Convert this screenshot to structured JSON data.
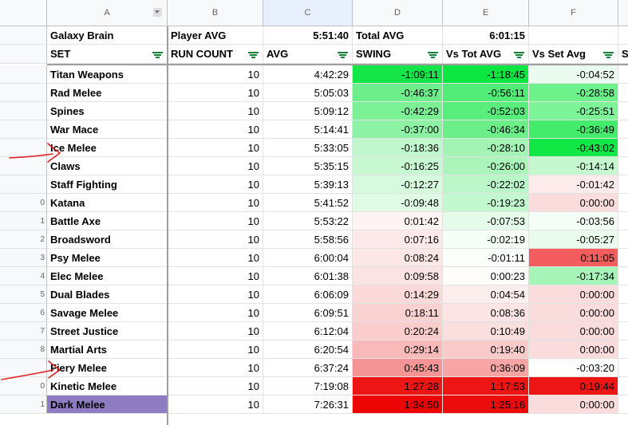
{
  "columns": [
    {
      "letter": "A",
      "selected": false,
      "dropdown": true
    },
    {
      "letter": "B",
      "selected": false,
      "dropdown": false
    },
    {
      "letter": "C",
      "selected": true,
      "dropdown": false
    },
    {
      "letter": "D",
      "selected": false,
      "dropdown": false
    },
    {
      "letter": "E",
      "selected": false,
      "dropdown": false
    },
    {
      "letter": "F",
      "selected": false,
      "dropdown": false
    }
  ],
  "summary": {
    "a": "Galaxy Brain",
    "b": "Player AVG",
    "c": "5:51:40",
    "d": "Total AVG",
    "e": "6:01:15",
    "f": ""
  },
  "headers": [
    "SET",
    "RUN COUNT",
    "AVG",
    "SWING",
    "Vs Tot AVG",
    "Vs Set Avg",
    "S"
  ],
  "row_numbers": [
    "",
    "",
    "",
    "",
    "",
    "",
    "",
    "",
    "",
    "0",
    "1",
    "2",
    "3",
    "4",
    "5",
    "6",
    "7",
    "8",
    "",
    "0",
    "1"
  ],
  "rows": [
    {
      "set": "Titan Weapons",
      "count": "10",
      "avg": "4:42:29",
      "swing": "-1:09:11",
      "vs_tot": "-1:18:45",
      "vs_set": "-0:04:52",
      "c_swing": "#16e54a",
      "c_tot": "#0be740",
      "c_set": "#ecfbef"
    },
    {
      "set": "Rad Melee",
      "count": "10",
      "avg": "5:05:03",
      "swing": "-0:46:37",
      "vs_tot": "-0:56:11",
      "vs_set": "-0:28:58",
      "c_swing": "#6eee8a",
      "c_tot": "#50ec75",
      "c_set": "#6df28b"
    },
    {
      "set": "Spines",
      "count": "10",
      "avg": "5:09:12",
      "swing": "-0:42:29",
      "vs_tot": "-0:52:03",
      "vs_set": "-0:25:51",
      "c_swing": "#7bf095",
      "c_tot": "#59ed7b",
      "c_set": "#7ef498"
    },
    {
      "set": "War Mace",
      "count": "10",
      "avg": "5:14:41",
      "swing": "-0:37:00",
      "vs_tot": "-0:46:34",
      "vs_set": "-0:36:49",
      "c_swing": "#8df2a3",
      "c_tot": "#6cef89",
      "c_set": "#43ed6b"
    },
    {
      "set": "Ice Melee",
      "count": "10",
      "avg": "5:33:05",
      "swing": "-0:18:36",
      "vs_tot": "-0:28:10",
      "vs_set": "-0:43:02",
      "c_swing": "#c1f7cc",
      "c_tot": "#a2f3b4",
      "c_set": "#11e845"
    },
    {
      "set": "Claws",
      "count": "10",
      "avg": "5:35:15",
      "swing": "-0:16:25",
      "vs_tot": "-0:26:00",
      "vs_set": "-0:14:14",
      "c_swing": "#c8f8d2",
      "c_tot": "#abf5bb",
      "c_set": "#c5f8cf"
    },
    {
      "set": "Staff Fighting",
      "count": "10",
      "avg": "5:39:13",
      "swing": "-0:12:27",
      "vs_tot": "-0:22:02",
      "vs_set": "-0:01:42",
      "c_swing": "#d6fadd",
      "c_tot": "#baf6c7",
      "c_set": "#fdeaea"
    },
    {
      "set": "Katana",
      "count": "10",
      "avg": "5:41:52",
      "swing": "-0:09:48",
      "vs_tot": "-0:19:23",
      "vs_set": "0:00:00",
      "c_swing": "#dffbe5",
      "c_tot": "#c2f8cd",
      "c_set": "#fbdcdc"
    },
    {
      "set": "Battle Axe",
      "count": "10",
      "avg": "5:53:22",
      "swing": "0:01:42",
      "vs_tot": "-0:07:53",
      "vs_set": "-0:03:56",
      "c_swing": "#fef4f4",
      "c_tot": "#e6fcea",
      "c_set": "#f4fdf6"
    },
    {
      "set": "Broadsword",
      "count": "10",
      "avg": "5:58:56",
      "swing": "0:07:16",
      "vs_tot": "-0:02:19",
      "vs_set": "-0:05:27",
      "c_swing": "#fde9e9",
      "c_tot": "#f6fef8",
      "c_set": "#eafbee"
    },
    {
      "set": "Psy Melee",
      "count": "10",
      "avg": "6:00:04",
      "swing": "0:08:24",
      "vs_tot": "-0:01:11",
      "vs_set": "0:11:05",
      "c_swing": "#fde6e6",
      "c_tot": "#fbfffc",
      "c_set": "#f35d5d"
    },
    {
      "set": "Elec Melee",
      "count": "10",
      "avg": "6:01:38",
      "swing": "0:09:58",
      "vs_tot": "0:00:23",
      "vs_set": "-0:17:34",
      "c_swing": "#fce3e3",
      "c_tot": "#fffcfc",
      "c_set": "#a7f4b8"
    },
    {
      "set": "Dual Blades",
      "count": "10",
      "avg": "6:06:09",
      "swing": "0:14:29",
      "vs_tot": "0:04:54",
      "vs_set": "0:00:00",
      "c_swing": "#fbd9d9",
      "c_tot": "#fdeeee",
      "c_set": "#fbdcdc"
    },
    {
      "set": "Savage Melee",
      "count": "10",
      "avg": "6:09:51",
      "swing": "0:18:11",
      "vs_tot": "0:08:36",
      "vs_set": "0:00:00",
      "c_swing": "#fad1d1",
      "c_tot": "#fce4e4",
      "c_set": "#fbdcdc"
    },
    {
      "set": "Street Justice",
      "count": "10",
      "avg": "6:12:04",
      "swing": "0:20:24",
      "vs_tot": "0:10:49",
      "vs_set": "0:00:00",
      "c_swing": "#facccc",
      "c_tot": "#fbdfdf",
      "c_set": "#fbdcdc"
    },
    {
      "set": "Martial Arts",
      "count": "10",
      "avg": "6:20:54",
      "swing": "0:29:14",
      "vs_tot": "0:19:40",
      "vs_set": "0:00:00",
      "c_swing": "#f8b9b9",
      "c_tot": "#f9caca",
      "c_set": "#fbdcdc"
    },
    {
      "set": "Fiery Melee",
      "count": "10",
      "avg": "6:37:24",
      "swing": "0:45:43",
      "vs_tot": "0:36:09",
      "vs_set": "-0:03:20",
      "c_swing": "#f49494",
      "c_tot": "#f6a4a4",
      "c_set": "#fdfffd"
    },
    {
      "set": "Kinetic Melee",
      "count": "10",
      "avg": "7:19:08",
      "swing": "1:27:28",
      "vs_tot": "1:17:53",
      "vs_set": "0:19:44",
      "c_swing": "#ee1515",
      "c_tot": "#ee1515",
      "c_set": "#ee1515"
    },
    {
      "set": "Dark Melee",
      "count": "10",
      "avg": "7:26:31",
      "swing": "1:34:50",
      "vs_tot": "1:25:16",
      "vs_set": "0:00:00",
      "c_swing": "#ed0505",
      "c_tot": "#ed0c0c",
      "c_set": "#fbdcdc",
      "highlight": "#8e7cc3"
    }
  ],
  "colors": {
    "header_bg": "#f8f9fa",
    "filter_icon": "#188038",
    "annotation_arrow": "#e02020",
    "highlight_cell": "#8e7cc3"
  },
  "annotations": [
    {
      "type": "hand-drawn-arrow",
      "points_to": "Ice Melee"
    },
    {
      "type": "hand-drawn-arrow",
      "points_to": "Fiery Melee"
    }
  ]
}
